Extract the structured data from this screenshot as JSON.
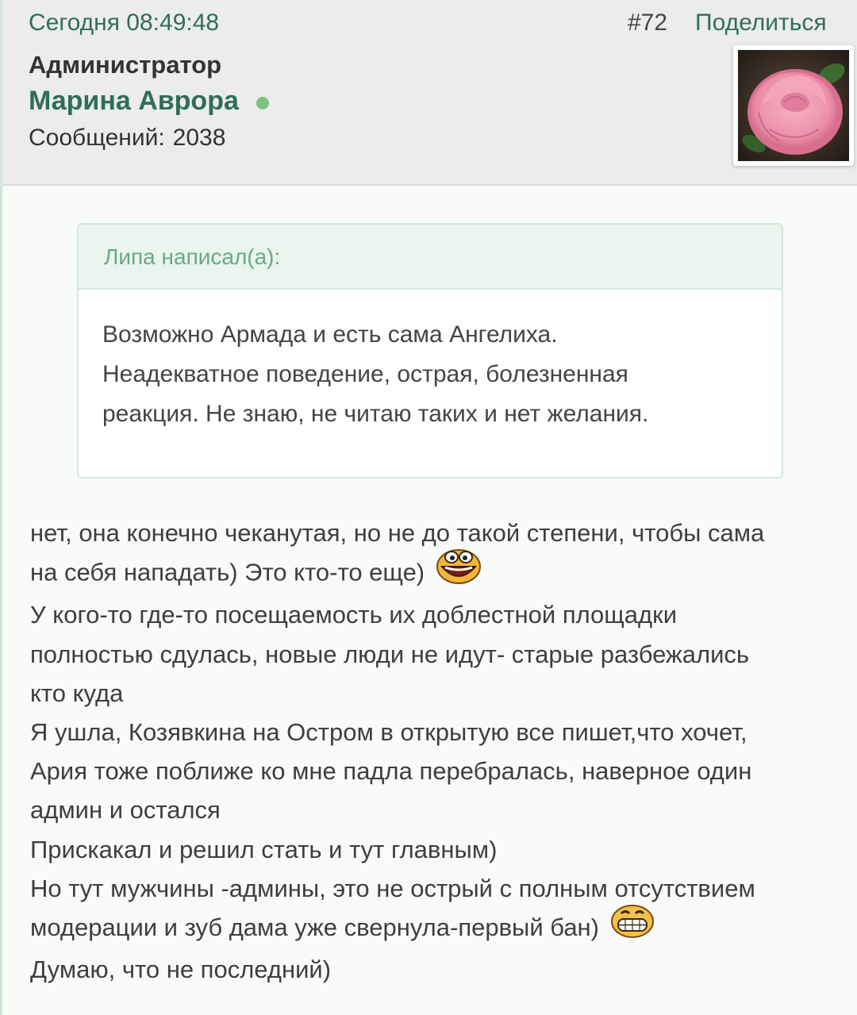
{
  "header": {
    "date": "Сегодня 08:49:48",
    "post_number": "#72",
    "share_label": "Поделиться",
    "user_group": "Администратор",
    "user_name": "Марина Аврора",
    "posts_label": "Сообщений:",
    "posts_count": "2038",
    "online_status_color": "#7bc47f",
    "avatar_icon": "pink-rose-avatar"
  },
  "quote": {
    "author_line": "Липа написал(а):",
    "lines": [
      "Возможно Армада и есть сама Ангелиха.",
      "Неадекватное поведение, острая, болезненная",
      "реакция. Не знаю, не читаю таких и нет желания."
    ]
  },
  "message": {
    "lines": [
      "нет, она конечно чеканутая, но не до такой степени, чтобы сама",
      "на себя нападать) Это кто-то еще)",
      "У кого-то где-то посещаемость их доблестной площадки",
      "полностью сдулась, новые люди не идут- старые разбежались",
      "кто куда",
      "Я ушла, Козявкина на Остром в открытую все пишет,что хочет,",
      "Ария тоже поближе ко мне падла перебралась, наверное один",
      "админ и остался",
      "Прискакал и решил стать и тут главным)",
      "Но тут мужчины -админы, это не острый с полным отсутствием",
      "модерации и зуб дама уже свернула-первый бан)",
      "Думаю, что не последний)"
    ],
    "smileys": {
      "line_1": "laughing-smiley-icon",
      "line_10": "grinning-smiley-icon"
    }
  },
  "colors": {
    "accent_green": "#2f6e59",
    "quote_header_bg": "#e9f5ee",
    "quote_header_text": "#6aa886",
    "header_bg": "#ececec"
  }
}
